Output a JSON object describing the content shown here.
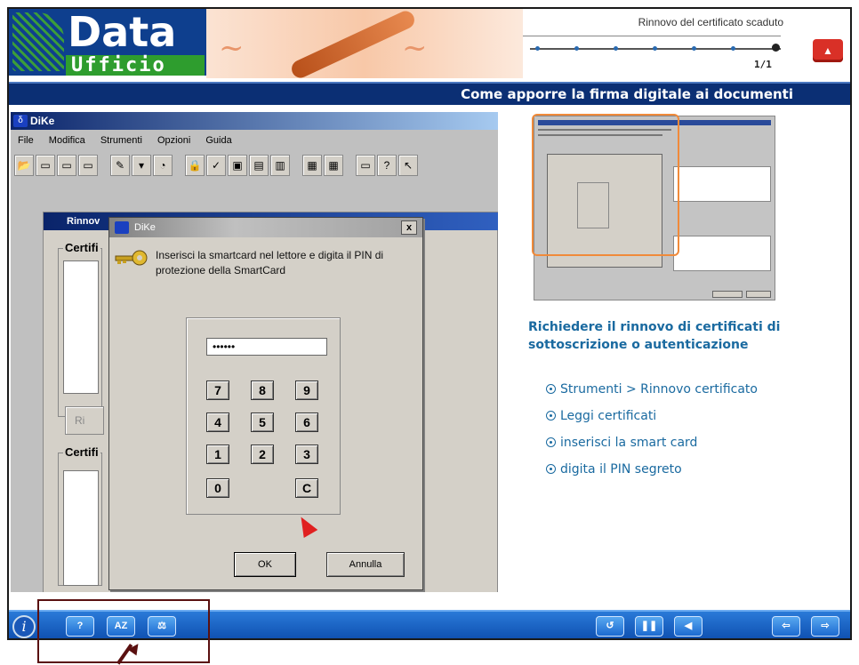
{
  "brand": {
    "line1": "Data",
    "line2": "Ufficio"
  },
  "progress": {
    "title": "Rinnovo del certificato scaduto",
    "count": "1/1",
    "fraction": 1.0
  },
  "section_title": "Come apporre la firma digitale ai documenti",
  "dike": {
    "title": "DiKe",
    "menu": [
      "File",
      "Modifica",
      "Strumenti",
      "Opzioni",
      "Guida"
    ],
    "inner_window_title": "Rinnov",
    "group1_label": "Certifi",
    "group2_label": "Certifi",
    "inner_button": "Ri",
    "dialog": {
      "title": "DiKe",
      "close": "x",
      "message": "Inserisci la smartcard nel lettore e digita il PIN di protezione della SmartCard",
      "pin_value": "••••••",
      "keys": [
        "7",
        "8",
        "9",
        "4",
        "5",
        "6",
        "1",
        "2",
        "3",
        "0",
        "C"
      ],
      "ok": "OK",
      "cancel": "Annulla"
    }
  },
  "right": {
    "title": "Richiedere il rinnovo di certificati di sottoscrizione o autenticazione",
    "steps": [
      "Strumenti > Rinnovo certificato",
      "Leggi certificati",
      "inserisci la smart card",
      "digita il PIN segreto"
    ]
  },
  "footer": {
    "left_icons": [
      "info-icon",
      "help-icon",
      "glossary-icon",
      "balance-icon"
    ],
    "left_labels": [
      "?",
      "AZ",
      "⚖"
    ],
    "right_icons": [
      "replay-icon",
      "pause-icon",
      "audio-icon",
      "back-icon",
      "forward-icon"
    ]
  },
  "colors": {
    "header_bar": "#0b2f74",
    "footer": "#1c6ad0",
    "accent": "#1a6aa0",
    "highlight": "#f08a3a",
    "annotation": "#5a1010"
  }
}
